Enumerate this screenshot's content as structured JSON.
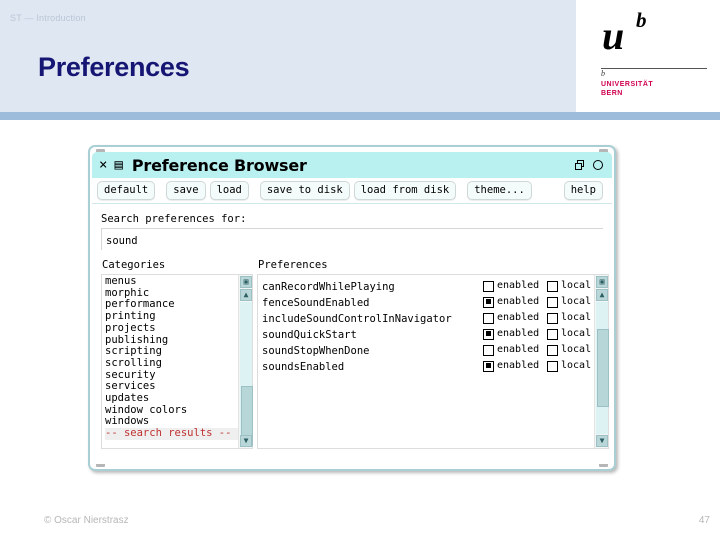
{
  "slide": {
    "kicker": "ST — Introduction",
    "title": "Preferences",
    "footer_copyright": "© Oscar Nierstrasz",
    "footer_page": "47",
    "logo": {
      "letter_u": "u",
      "letter_b": "b",
      "tick": "b",
      "line1": "UNIVERSITÄT",
      "line2": "BERN"
    },
    "colors": {
      "header_band": "#dfe7f2",
      "header_rule": "#9dbcdc",
      "title": "#151573",
      "logo_red": "#d1004e"
    }
  },
  "window": {
    "title": "Preference Browser",
    "titlebar_color": "#b9f1f1",
    "icons": {
      "close": "×",
      "menu": "▤",
      "collapse": "windows-icon",
      "expand": "circle-icon"
    },
    "toolbar": {
      "default": "default",
      "save": "save",
      "load": "load",
      "save_to_disk": "save to disk",
      "load_from_disk": "load from disk",
      "theme": "theme...",
      "help": "help"
    },
    "search": {
      "label": "Search preferences for:",
      "value": "sound",
      "placeholder": ""
    },
    "columns": {
      "categories": "Categories",
      "preferences": "Preferences"
    },
    "categories": [
      {
        "label": "menus",
        "selected": false
      },
      {
        "label": "morphic",
        "selected": false
      },
      {
        "label": "performance",
        "selected": false
      },
      {
        "label": "printing",
        "selected": false
      },
      {
        "label": "projects",
        "selected": false
      },
      {
        "label": "publishing",
        "selected": false
      },
      {
        "label": "scripting",
        "selected": false
      },
      {
        "label": "scrolling",
        "selected": false
      },
      {
        "label": "security",
        "selected": false
      },
      {
        "label": "services",
        "selected": false
      },
      {
        "label": "updates",
        "selected": false
      },
      {
        "label": "window colors",
        "selected": false
      },
      {
        "label": "windows",
        "selected": false
      },
      {
        "label": "-- search results --",
        "selected": true
      }
    ],
    "preferences": [
      {
        "name": "canRecordWhilePlaying",
        "enabled": false,
        "local": false
      },
      {
        "name": "fenceSoundEnabled",
        "enabled": true,
        "local": false
      },
      {
        "name": "includeSoundControlInNavigator",
        "enabled": false,
        "local": false
      },
      {
        "name": "soundQuickStart",
        "enabled": true,
        "local": false
      },
      {
        "name": "soundStopWhenDone",
        "enabled": false,
        "local": false
      },
      {
        "name": "soundsEnabled",
        "enabled": true,
        "local": false
      }
    ],
    "checkbox_labels": {
      "enabled": "enabled",
      "local": "local"
    },
    "scrollbar_glyphs": {
      "menu": "▣",
      "up": "▲",
      "down": "▼"
    }
  }
}
